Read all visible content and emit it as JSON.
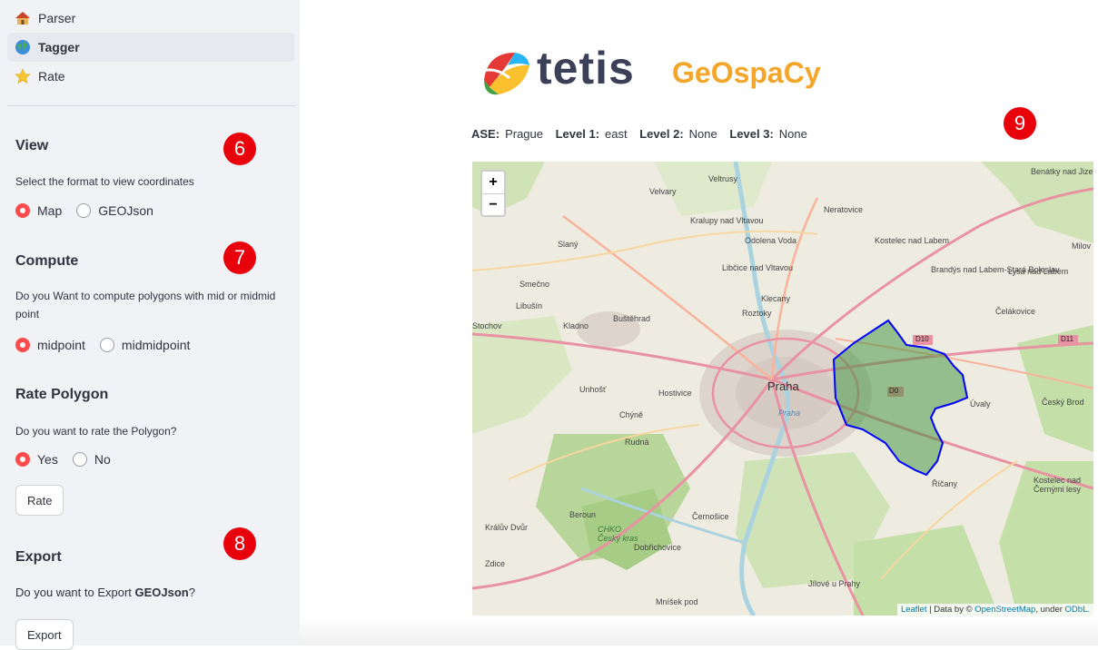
{
  "sidebar": {
    "nav": [
      {
        "label": "Parser",
        "icon": "house-icon"
      },
      {
        "label": "Tagger",
        "icon": "globe-icon",
        "active": true
      },
      {
        "label": "Rate",
        "icon": "star-icon"
      }
    ],
    "view": {
      "title": "View",
      "description": "Select the format to view coordinates",
      "options": [
        "Map",
        "GEOJson"
      ],
      "selected": "Map"
    },
    "compute": {
      "title": "Compute",
      "description": "Do you Want to compute polygons with mid or midmid point",
      "options": [
        "midpoint",
        "midmidpoint"
      ],
      "selected": "midpoint"
    },
    "rate_polygon": {
      "title": "Rate Polygon",
      "description": "Do you want to rate the Polygon?",
      "options": [
        "Yes",
        "No"
      ],
      "selected": "Yes",
      "button_label": "Rate"
    },
    "export": {
      "title": "Export",
      "description_prefix": "Do you want to Export ",
      "description_bold": "GEOJson",
      "description_suffix": "?",
      "button_label": "Export"
    }
  },
  "badges": {
    "b6": "6",
    "b7": "7",
    "b8": "8",
    "b9": "9"
  },
  "logo": {
    "tetis": "tetis",
    "geospacy": "GeOspaCy"
  },
  "ase_line": {
    "ase_label": "ASE:",
    "ase_value": "Prague",
    "l1_label": "Level 1:",
    "l1_value": "east",
    "l2_label": "Level 2:",
    "l2_value": "None",
    "l3_label": "Level 3:",
    "l3_value": "None"
  },
  "map": {
    "zoom_in": "+",
    "zoom_out": "−",
    "attribution": {
      "leaflet": "Leaflet",
      "mid": " | Data by © ",
      "osm": "OpenStreetMap",
      "under": ", under ",
      "odbl": "ODbL."
    },
    "labels": {
      "benatky": "Benátky nad Jizerou",
      "velvary": "Velvary",
      "veltrusy": "Veltrusy",
      "neratovice": "Neratovice",
      "kralupy": "Kralupy nad Vltavou",
      "odolena": "Odolena Voda",
      "kostelec_labem": "Kostelec nad Labem",
      "slany": "Slaný",
      "milovice": "Milov",
      "brandys": "Brandýs nad Labem-Stará Boleslav",
      "lysa": "Lysá nad Labem",
      "smecno": "Smečno",
      "libcice": "Libčice nad Vltavou",
      "libusin": "Libušín",
      "klecany": "Klecany",
      "stochov": "Stochov",
      "kladno": "Kladno",
      "bustehrad": "Buštěhrad",
      "roztoky": "Roztoky",
      "celakovice": "Čelákovice",
      "d10": "D10",
      "d11": "D11",
      "unhost": "Unhošť",
      "hostivice": "Hostivice",
      "praha": "Praha",
      "praha_river": "Praha",
      "d0": "D0",
      "uvaly": "Úvaly",
      "cesky_brod": "Český Brod",
      "chyne": "Chýně",
      "rudna": "Rudná",
      "ricany": "Říčany",
      "kostelec_lesy": "Kostelec nad Černými lesy",
      "beroun": "Beroun",
      "kraluv": "Králův Dvůr",
      "chko": "CHKO Český kras",
      "cernosice": "Černošice",
      "dobrichovice": "Dobřichovice",
      "zdice": "Zdice",
      "jilove": "Jílové u Prahy",
      "mnisek": "Mníšek pod"
    }
  },
  "colors": {
    "accent": "#ff4b4b",
    "badge": "#e8000b",
    "polygon_stroke": "#0000ff",
    "polygon_fill": "#3a8f3a",
    "logo_text": "#3b3f58",
    "logo_orange": "#f4a62a"
  }
}
